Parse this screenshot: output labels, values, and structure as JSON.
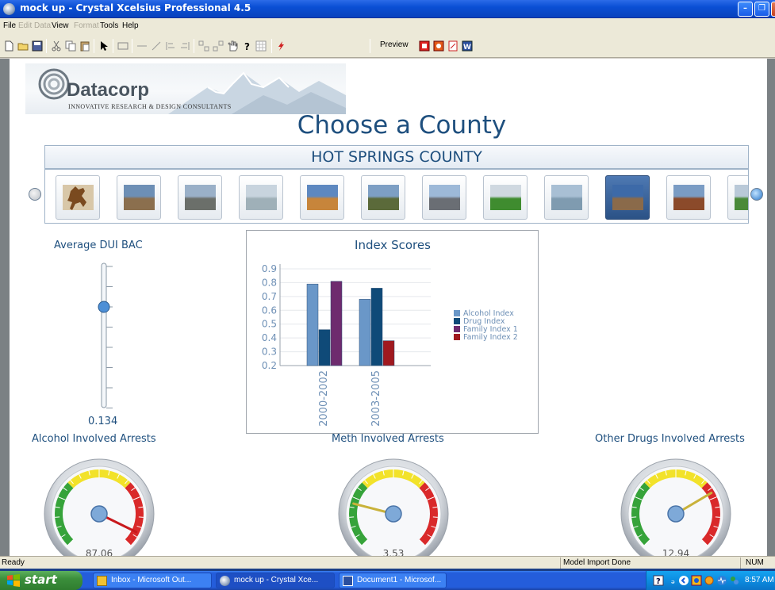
{
  "window": {
    "title": "mock up - Crystal Xcelsius Professional 4.5"
  },
  "menu": {
    "items": [
      "File",
      "Edit",
      "Data",
      "View",
      "Format",
      "Tools",
      "Help"
    ],
    "disabled": [
      false,
      true,
      true,
      false,
      true,
      false,
      false
    ]
  },
  "toolbar": {
    "preview_label": "Preview"
  },
  "dashboard": {
    "logo": {
      "brand": "Datacorp",
      "tagline": "INNOVATIVE RESEARCH & DESIGN CONSULTANTS"
    },
    "heading": "Choose a County",
    "selected_county": "HOT SPRINGS COUNTY",
    "thumbnails": [
      {
        "name": "thumb-bucking-horse",
        "colors": [
          "#7a4a1f",
          "#d8c7a8"
        ]
      },
      {
        "name": "thumb-rock-formation",
        "colors": [
          "#6d8fb5",
          "#8b6f4e"
        ]
      },
      {
        "name": "thumb-valley",
        "colors": [
          "#9ab0c8",
          "#6b6f6a"
        ]
      },
      {
        "name": "thumb-misty-plain",
        "colors": [
          "#c8d4de",
          "#9fb0b8"
        ]
      },
      {
        "name": "thumb-canyon",
        "colors": [
          "#5d88c0",
          "#c7853b"
        ]
      },
      {
        "name": "thumb-lake",
        "colors": [
          "#7d9fc4",
          "#5b6a3a"
        ]
      },
      {
        "name": "thumb-butte",
        "colors": [
          "#9db9d8",
          "#6a6e74"
        ]
      },
      {
        "name": "thumb-grassland",
        "colors": [
          "#cfd8e0",
          "#3f8c2f"
        ]
      },
      {
        "name": "thumb-river",
        "colors": [
          "#a8bfd4",
          "#7f9bb0"
        ]
      },
      {
        "name": "thumb-stone-arch",
        "colors": [
          "#3d6aa8",
          "#8a6a4a"
        ]
      },
      {
        "name": "thumb-sign",
        "colors": [
          "#7a9cc4",
          "#8b4a2a"
        ]
      },
      {
        "name": "thumb-meadow",
        "colors": [
          "#b9c9d8",
          "#4a8a3a"
        ]
      }
    ],
    "selected_thumbnail": 9,
    "dui": {
      "title": "Average DUI BAC",
      "value": "0.134",
      "level": 0.7
    },
    "gauges": [
      {
        "title": "Alcohol Involved Arrests",
        "value_label": "87.06",
        "fraction": 0.93
      },
      {
        "title": "Meth Involved Arrests",
        "value_label": "3.53",
        "fraction": 0.22
      },
      {
        "title": "Other Drugs Involved Arrests",
        "value_label": "12.94",
        "fraction": 0.72
      }
    ]
  },
  "chart_data": {
    "type": "bar",
    "title": "Index Scores",
    "categories": [
      "2000-2002",
      "2003-2005"
    ],
    "series": [
      {
        "name": "Alcohol Index",
        "color": "#6a97c8",
        "values": [
          0.79,
          0.68
        ]
      },
      {
        "name": "Drug Index",
        "color": "#0f4a78",
        "values": [
          0.46,
          0.76
        ]
      },
      {
        "name": "Family Index 1",
        "color": "#6e2b6e",
        "values": [
          0.81,
          null
        ]
      },
      {
        "name": "Family Index 2",
        "color": "#a0191f",
        "values": [
          null,
          0.38
        ]
      }
    ],
    "ylim": [
      0.2,
      0.9
    ],
    "yticks": [
      "0.9",
      "0.8",
      "0.7",
      "0.6",
      "0.5",
      "0.4",
      "0.3",
      "0.2"
    ],
    "legend": "right",
    "grid": true
  },
  "status": {
    "left": "Ready",
    "middle": "Model Import Done",
    "num": "NUM"
  },
  "taskbar": {
    "start_label": "start",
    "buttons": [
      "Inbox - Microsoft Out...",
      "mock up - Crystal Xce...",
      "Document1 - Microsof..."
    ],
    "active_index": 1,
    "clock": "8:57 AM"
  }
}
